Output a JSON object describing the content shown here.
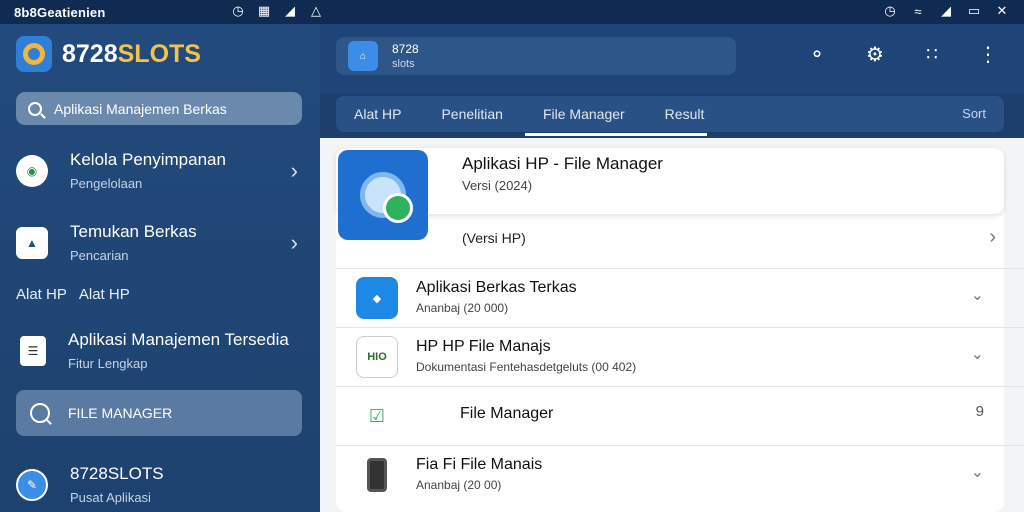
{
  "statusbar": {
    "left_text": "8b8Geatienien",
    "left_icons": [
      "clock-icon",
      "sd-card-icon",
      "signal-icon",
      "alert-icon"
    ],
    "right_icons": [
      "clock-icon",
      "wifi-icon",
      "signal-icon",
      "battery-icon",
      "close-icon"
    ]
  },
  "sidebar": {
    "brand": {
      "name_main": "8728",
      "name_accent": "SLOTS"
    },
    "search_placeholder": "Aplikasi Manajemen Berkas",
    "search_text": "Aplikasi Manajemen Berkas",
    "items": [
      {
        "title": "Kelola Penyimpanan",
        "subtitle": "Pengelolaan"
      },
      {
        "title": "Temukan Berkas",
        "subtitle": "Pencarian"
      }
    ],
    "section_label": "Alat HP",
    "section_title": "Alat HP",
    "item3": {
      "title": "Aplikasi Manajemen Tersedia",
      "subtitle": "Fitur Lengkap"
    },
    "active_item": {
      "label": "FILE MANAGER"
    },
    "footer": {
      "title": "8728SLOTS",
      "subtitle": "Pusat Aplikasi"
    }
  },
  "topbar": {
    "app_line1": "8728",
    "app_line2": "slots",
    "icons": [
      "chat-icon",
      "gear-icon",
      "apps-grid-icon",
      "more-vert-icon"
    ]
  },
  "tabs": {
    "items": [
      "Alat HP",
      "Penelitian",
      "File Manager",
      "Result"
    ],
    "active": "File Manager",
    "right_label": "Sort"
  },
  "main": {
    "hero": {
      "title": "Aplikasi HP - File Manager",
      "subtitle": "Versi (2024)",
      "meta": "(Versi HP)"
    },
    "rows": [
      {
        "title": "Aplikasi Berkas Terkas",
        "subtitle": "Ananbaj (20 000)",
        "icon": "folder-icon",
        "trail": "chevron-down-icon"
      },
      {
        "title": "HP HP File Manajs",
        "subtitle": "Dokumentasi Fentehasdetgeluts (00 402)",
        "icon": "hio-logo-icon",
        "trail": "chevron-down-icon"
      },
      {
        "title": "File Manager",
        "subtitle": "",
        "icon": "folder-check-icon",
        "trail_text": "9"
      },
      {
        "title": "Fia Fi File Manais",
        "subtitle": "Ananbaj (20 00)",
        "icon": "phone-icon",
        "trail": "chevron-down-icon"
      }
    ]
  }
}
